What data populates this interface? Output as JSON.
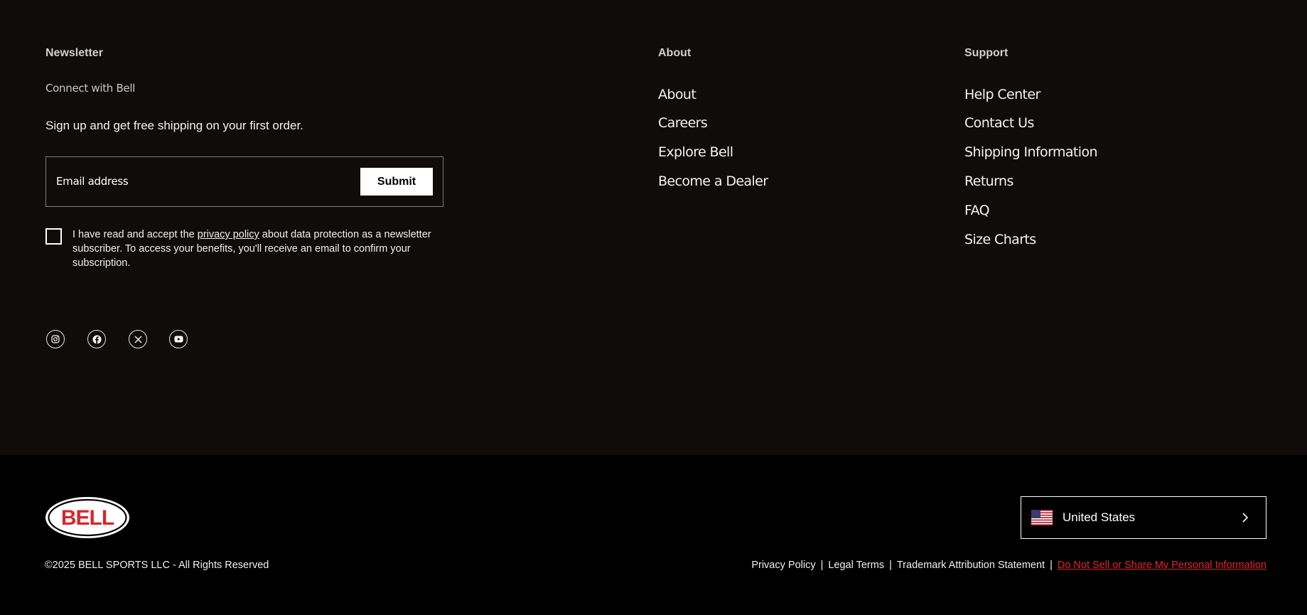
{
  "newsletter": {
    "title": "Newsletter",
    "connect": "Connect with Bell",
    "lead": "Sign up and get free shipping on your first order.",
    "email_placeholder": "Email address",
    "submit_label": "Submit",
    "consent_before": "I have read and accept the ",
    "consent_link": "privacy policy",
    "consent_after": " about data protection as a newsletter subscriber. To access your benefits, you'll receive an email to confirm your subscription."
  },
  "social": [
    {
      "name": "instagram-icon"
    },
    {
      "name": "facebook-icon"
    },
    {
      "name": "x-icon"
    },
    {
      "name": "youtube-icon"
    }
  ],
  "about": {
    "title": "About",
    "links": [
      "About",
      "Careers",
      "Explore Bell",
      "Become a Dealer"
    ]
  },
  "support": {
    "title": "Support",
    "links": [
      "Help Center",
      "Contact Us",
      "Shipping Information",
      "Returns",
      "FAQ",
      "Size Charts"
    ]
  },
  "footer": {
    "logo_text": "BELL",
    "country": "United States",
    "copyright": "©2025 BELL SPORTS LLC - All Rights Reserved",
    "legal_links": [
      "Privacy Policy",
      "Legal Terms",
      "Trademark Attribution Statement",
      "Do Not Sell or Share My Personal Information"
    ],
    "separator": "|"
  },
  "colors": {
    "background_top": "#0f0d0c",
    "background_bottom": "#000000",
    "accent_red": "#e2262b"
  }
}
